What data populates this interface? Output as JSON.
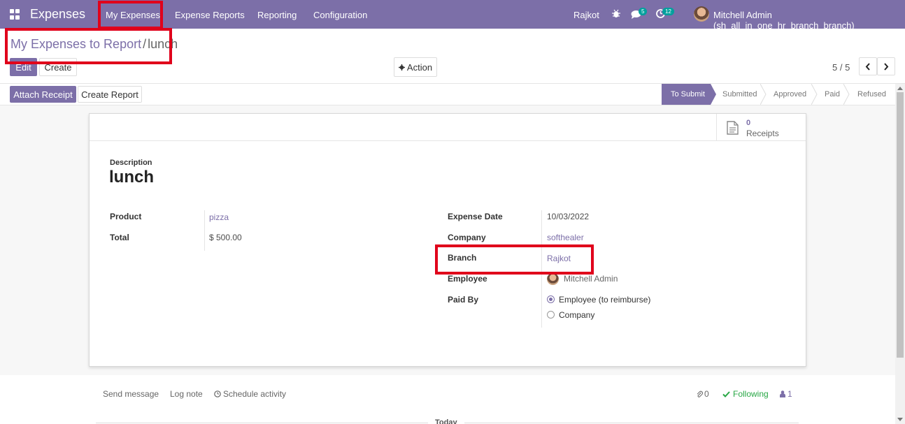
{
  "navbar": {
    "app_title": "Expenses",
    "menu": [
      {
        "label": "My Expenses"
      },
      {
        "label": "Expense Reports"
      },
      {
        "label": "Reporting"
      },
      {
        "label": "Configuration"
      }
    ],
    "branch": "Rajkot",
    "messages_count": "5",
    "activities_count": "12",
    "user": "Mitchell Admin (sh_all_in_one_hr_branch_branch)"
  },
  "breadcrumb": {
    "parent": "My Expenses to Report",
    "separator": "/",
    "current": "lunch"
  },
  "toolbar": {
    "edit_label": "Edit",
    "create_label": "Create",
    "action_label": "Action",
    "pager": "5 / 5"
  },
  "header_buttons": {
    "attach_receipt": "Attach Receipt",
    "create_report": "Create Report"
  },
  "statusbar": {
    "steps": [
      "To Submit",
      "Submitted",
      "Approved",
      "Paid",
      "Refused"
    ],
    "active": "To Submit"
  },
  "smart_button": {
    "count": "0",
    "label": "Receipts"
  },
  "form": {
    "description_label": "Description",
    "description": "lunch",
    "product_label": "Product",
    "product": "pizza",
    "total_label": "Total",
    "total": "$ 500.00",
    "expense_date_label": "Expense Date",
    "expense_date": "10/03/2022",
    "company_label": "Company",
    "company": "softhealer",
    "branch_label": "Branch",
    "branch": "Rajkot",
    "employee_label": "Employee",
    "employee": "Mitchell Admin",
    "paid_by_label": "Paid By",
    "paid_by_options": [
      "Employee (to reimburse)",
      "Company"
    ],
    "paid_by_selected": "Employee (to reimburse)"
  },
  "chatter": {
    "send_message": "Send message",
    "log_note": "Log note",
    "schedule_activity": "Schedule activity",
    "attachments_count": "0",
    "following": "Following",
    "followers_count": "1",
    "today": "Today"
  },
  "colors": {
    "brand": "#7c6fa8",
    "highlight": "#e0001b",
    "following": "#28a745"
  }
}
